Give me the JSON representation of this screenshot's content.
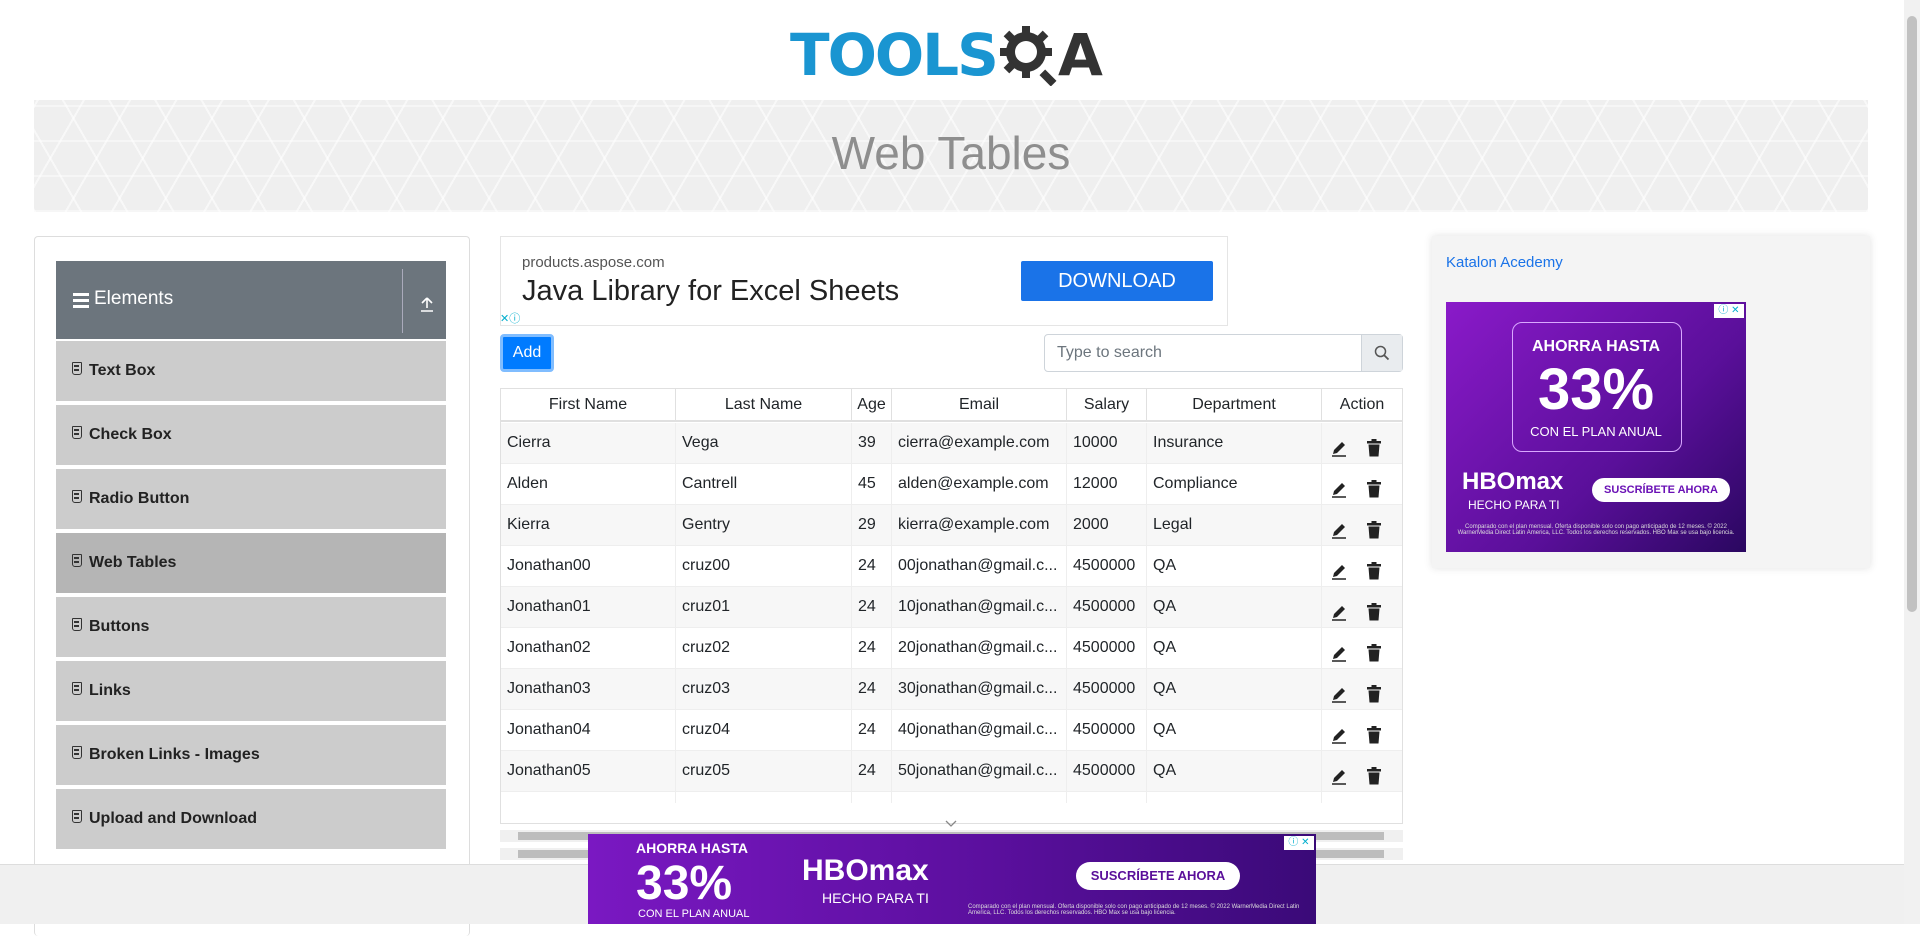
{
  "brand": {
    "logo_text": "TOOLS",
    "logo_qa": "QA"
  },
  "page": {
    "title": "Web Tables"
  },
  "sidebar": {
    "group_title": "Elements",
    "items": [
      {
        "label": "Text Box"
      },
      {
        "label": "Check Box"
      },
      {
        "label": "Radio Button"
      },
      {
        "label": "Web Tables",
        "active": true
      },
      {
        "label": "Buttons"
      },
      {
        "label": "Links"
      },
      {
        "label": "Broken Links - Images"
      },
      {
        "label": "Upload and Download"
      }
    ]
  },
  "top_ad": {
    "domain": "products.aspose.com",
    "headline": "Java Library for Excel Sheets",
    "button": "DOWNLOAD"
  },
  "toolbar": {
    "add_label": "Add",
    "search_placeholder": "Type to search"
  },
  "table": {
    "columns": [
      "First Name",
      "Last Name",
      "Age",
      "Email",
      "Salary",
      "Department",
      "Action"
    ],
    "rows": [
      [
        "Cierra",
        "Vega",
        "39",
        "cierra@example.com",
        "10000",
        "Insurance"
      ],
      [
        "Alden",
        "Cantrell",
        "45",
        "alden@example.com",
        "12000",
        "Compliance"
      ],
      [
        "Kierra",
        "Gentry",
        "29",
        "kierra@example.com",
        "2000",
        "Legal"
      ],
      [
        "Jonathan00",
        "cruz00",
        "24",
        "00jonathan@gmail.c...",
        "4500000",
        "QA"
      ],
      [
        "Jonathan01",
        "cruz01",
        "24",
        "10jonathan@gmail.c...",
        "4500000",
        "QA"
      ],
      [
        "Jonathan02",
        "cruz02",
        "24",
        "20jonathan@gmail.c...",
        "4500000",
        "QA"
      ],
      [
        "Jonathan03",
        "cruz03",
        "24",
        "30jonathan@gmail.c...",
        "4500000",
        "QA"
      ],
      [
        "Jonathan04",
        "cruz04",
        "24",
        "40jonathan@gmail.c...",
        "4500000",
        "QA"
      ],
      [
        "Jonathan05",
        "cruz05",
        "24",
        "50jonathan@gmail.c...",
        "4500000",
        "QA"
      ]
    ]
  },
  "right_ad": {
    "image_alt": "Katalon Acedemy",
    "line1": "AHORRA HASTA",
    "percent": "33%",
    "line3": "CON EL PLAN ANUAL",
    "brand": "HBOmax",
    "tagline": "HECHO PARA TI",
    "cta": "SUSCRÍBETE AHORA",
    "fine_print": "Comparado con el plan mensual. Oferta disponible solo con pago anticipado de 12 meses. © 2022 WarnerMedia Direct Latin America, LLC. Todos los derechos reservados. HBO Max se usa bajo licencia."
  },
  "bottom_ad": {
    "line1": "AHORRA HASTA",
    "percent": "33%",
    "line3": "CON EL PLAN ANUAL",
    "brand": "HBOmax",
    "tagline": "HECHO PARA TI",
    "cta": "SUSCRÍBETE AHORA",
    "fine_print": "Comparado con el plan mensual. Oferta disponible solo con pago anticipado de 12 meses. © 2022 WarnerMedia Direct Latin America, LLC. Todos los derechos reservados. HBO Max se usa bajo licencia."
  },
  "colors": {
    "accent": "#007bff",
    "sidebar_header": "#6c757d",
    "logo_blue": "#1a95d1"
  }
}
